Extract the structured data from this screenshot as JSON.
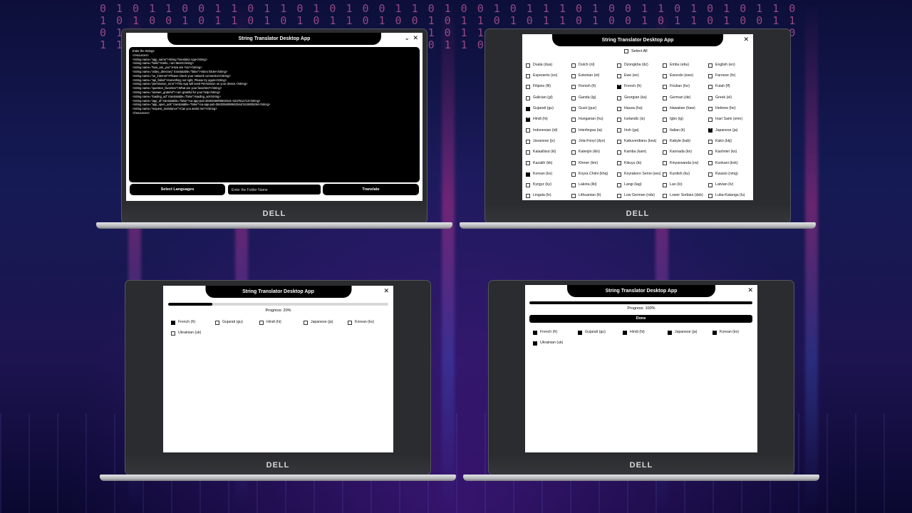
{
  "background": {
    "digits": "0101100110110101001101001011101001101010110101001011010101101001011010110100101101001101011010010110100110101101001011010010110101101001011010010110101101001011"
  },
  "brand": "DELL",
  "window_title": "String Translator Desktop App",
  "window_controls": {
    "minimize": "⌄",
    "close": "✕"
  },
  "screen1": {
    "editor_lines": [
      "Enter the Strings",
      "<resources>",
      "    <string name=\"app_name\">String Translator App</string>",
      "    <string name=\"hello\">Hello, I am Meet</string>",
      "    <string name=\"how_are_you\">How are You?</string>",
      "    <string name=\"video_directory\" translatable=\"false\">Video folder</string>",
      "    <string name=\"no_internet\">Please check your network connection</string>",
      "    <string name=\"api_failed\">Something not right, Please try again</string>",
      "    <string name=\"permission_error\">This App will need Permission on your device.</string>",
      "    <string name=\"question_favorites\">What are your favorites?</string>",
      "    <string name=\"answer_grateful\">I am grateful for your help</string>",
      "    <string name=\"loading_ad\" translatable=\"false\">loading_ad</string>",
      "    <string name=\"app_id\" translatable=\"false\">ca-app-pub-3940256099942544~3347511713</string>",
      "    <string name=\"app_open_ads\" translatable=\"false\">ca-app-pub-3940256099942544/3419835294</string>",
      "    <string name=\"request_assistance\">Can you assist me?</string>",
      "</resources>"
    ],
    "select_languages_label": "Select Languages",
    "folder_placeholder": "Enter the Folder Name",
    "translate_label": "Translate"
  },
  "screen2": {
    "select_all_label": "Select All",
    "languages": [
      {
        "label": "Duala (dua)",
        "checked": false
      },
      {
        "label": "Dutch (nl)",
        "checked": false
      },
      {
        "label": "Dzongkha (dz)",
        "checked": false
      },
      {
        "label": "Embu (ebu)",
        "checked": false
      },
      {
        "label": "English (en)",
        "checked": false
      },
      {
        "label": "Esperanto (eo)",
        "checked": false
      },
      {
        "label": "Estonian (et)",
        "checked": false
      },
      {
        "label": "Ewe (ee)",
        "checked": false
      },
      {
        "label": "Ewondo (ewo)",
        "checked": false
      },
      {
        "label": "Faroese (fo)",
        "checked": false
      },
      {
        "label": "Filipino (fil)",
        "checked": false
      },
      {
        "label": "Finnish (fi)",
        "checked": false
      },
      {
        "label": "French (fr)",
        "checked": true
      },
      {
        "label": "Friulian (fur)",
        "checked": false
      },
      {
        "label": "Fulah (ff)",
        "checked": false
      },
      {
        "label": "Galician (gl)",
        "checked": false
      },
      {
        "label": "Ganda (lg)",
        "checked": false
      },
      {
        "label": "Georgian (ka)",
        "checked": false
      },
      {
        "label": "German (de)",
        "checked": false
      },
      {
        "label": "Greek (el)",
        "checked": false
      },
      {
        "label": "Gujarati (gu)",
        "checked": true
      },
      {
        "label": "Gusii (guz)",
        "checked": false
      },
      {
        "label": "Hausa (ha)",
        "checked": false
      },
      {
        "label": "Hawaiian (haw)",
        "checked": false
      },
      {
        "label": "Hebrew (he)",
        "checked": false
      },
      {
        "label": "Hindi (hi)",
        "checked": true
      },
      {
        "label": "Hungarian (hu)",
        "checked": false
      },
      {
        "label": "Icelandic (is)",
        "checked": false
      },
      {
        "label": "Igbo (ig)",
        "checked": false
      },
      {
        "label": "Inari Sami (smn)",
        "checked": false
      },
      {
        "label": "Indonesian (id)",
        "checked": false
      },
      {
        "label": "Interlingua (ia)",
        "checked": false
      },
      {
        "label": "Irish (ga)",
        "checked": false
      },
      {
        "label": "Italian (it)",
        "checked": false
      },
      {
        "label": "Japanese (ja)",
        "checked": true
      },
      {
        "label": "Javanese (jv)",
        "checked": false
      },
      {
        "label": "Jola-Fonyi (dyo)",
        "checked": false
      },
      {
        "label": "Kabuverdianu (kea)",
        "checked": false
      },
      {
        "label": "Kabyle (kab)",
        "checked": false
      },
      {
        "label": "Kako (kkj)",
        "checked": false
      },
      {
        "label": "Kalaallisut (kl)",
        "checked": false
      },
      {
        "label": "Kalenjin (kln)",
        "checked": false
      },
      {
        "label": "Kamba (kam)",
        "checked": false
      },
      {
        "label": "Kannada (kn)",
        "checked": false
      },
      {
        "label": "Kashmiri (ks)",
        "checked": false
      },
      {
        "label": "Kazakh (kk)",
        "checked": false
      },
      {
        "label": "Khmer (km)",
        "checked": false
      },
      {
        "label": "Kikuyu (ki)",
        "checked": false
      },
      {
        "label": "Kinyarwanda (rw)",
        "checked": false
      },
      {
        "label": "Konkani (kok)",
        "checked": false
      },
      {
        "label": "Korean (ko)",
        "checked": true
      },
      {
        "label": "Koyra Chiini (khq)",
        "checked": false
      },
      {
        "label": "Koyraboro Senni (ses)",
        "checked": false
      },
      {
        "label": "Kurdish (ku)",
        "checked": false
      },
      {
        "label": "Kwasio (nmg)",
        "checked": false
      },
      {
        "label": "Kyrgyz (ky)",
        "checked": false
      },
      {
        "label": "Lakota (lkt)",
        "checked": false
      },
      {
        "label": "Langi (lag)",
        "checked": false
      },
      {
        "label": "Lao (lo)",
        "checked": false
      },
      {
        "label": "Latvian (lv)",
        "checked": false
      },
      {
        "label": "Lingala (ln)",
        "checked": false
      },
      {
        "label": "Lithuanian (lt)",
        "checked": false
      },
      {
        "label": "Low German (nds)",
        "checked": false
      },
      {
        "label": "Lower Sorbian (dsb)",
        "checked": false
      },
      {
        "label": "Luba-Katanga (lu)",
        "checked": false
      }
    ]
  },
  "screen3": {
    "progress_label": "Progress: 20%",
    "progress": 0.2,
    "languages": [
      {
        "label": "French (fr)",
        "checked": true
      },
      {
        "label": "Gujarati (gu)",
        "checked": false
      },
      {
        "label": "Hindi (hi)",
        "checked": false
      },
      {
        "label": "Japanese (ja)",
        "checked": false
      },
      {
        "label": "Korean (ko)",
        "checked": false
      },
      {
        "label": "Ukrainian (uk)",
        "checked": false
      }
    ]
  },
  "screen4": {
    "progress_label": "Progress: 100%",
    "progress": 1.0,
    "done_label": "Done",
    "languages": [
      {
        "label": "French (fr)",
        "checked": true
      },
      {
        "label": "Gujarati (gu)",
        "checked": true
      },
      {
        "label": "Hindi (hi)",
        "checked": true
      },
      {
        "label": "Japanese (ja)",
        "checked": true
      },
      {
        "label": "Korean (ko)",
        "checked": true
      },
      {
        "label": "Ukrainian (uk)",
        "checked": true
      }
    ]
  }
}
